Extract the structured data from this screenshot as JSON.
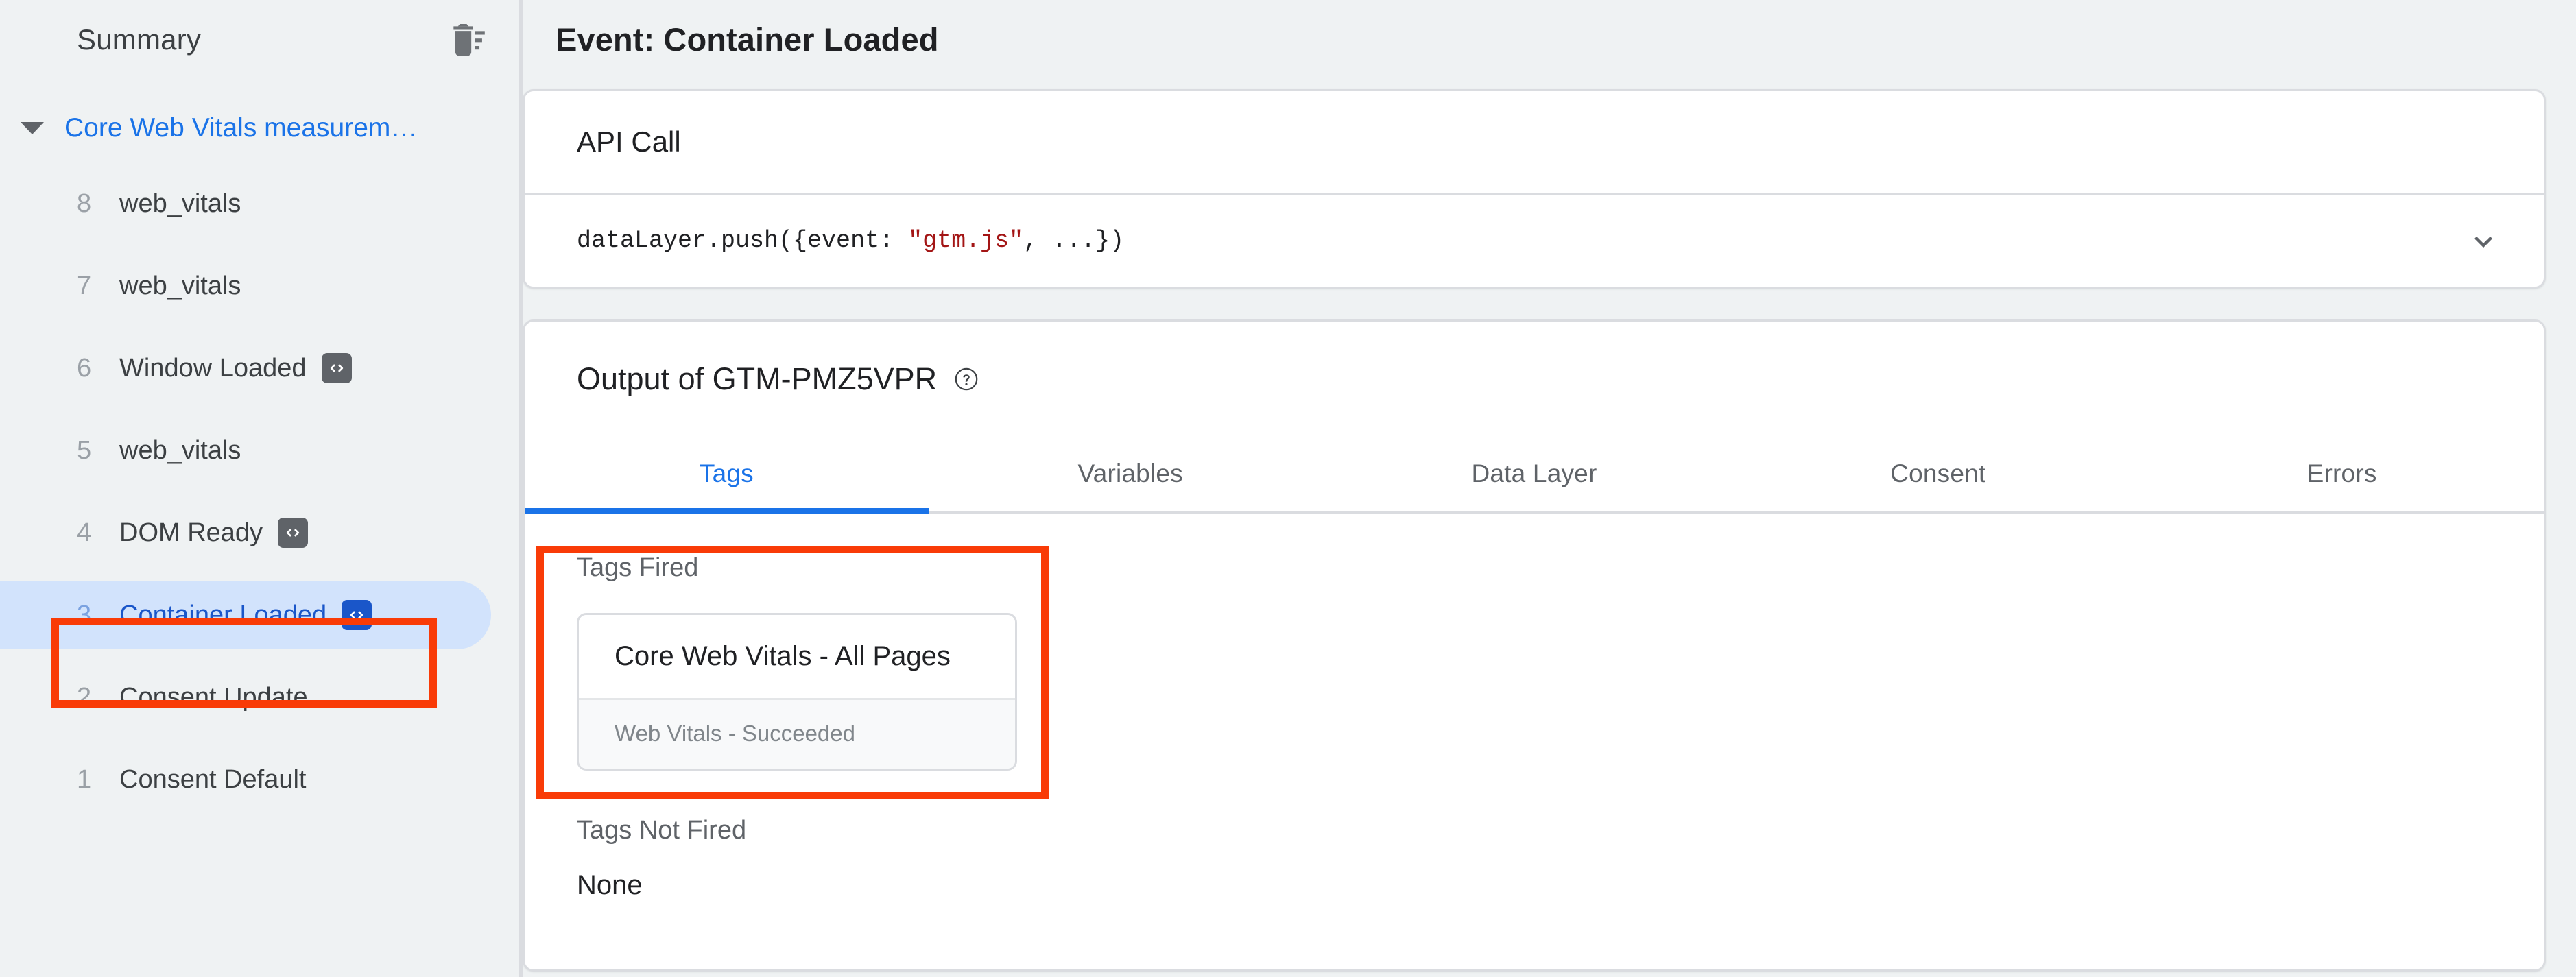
{
  "sidebar": {
    "title": "Summary",
    "clear_icon": "delete-sweep-icon",
    "group": {
      "label": "Core Web Vitals measurem…",
      "caret_icon": "caret-down-icon",
      "expanded": true
    },
    "events": [
      {
        "index": "8",
        "label": "web_vitals",
        "badge": false,
        "selected": false
      },
      {
        "index": "7",
        "label": "web_vitals",
        "badge": false,
        "selected": false
      },
      {
        "index": "6",
        "label": "Window Loaded",
        "badge": true,
        "selected": false,
        "badge_icon": "code-icon"
      },
      {
        "index": "5",
        "label": "web_vitals",
        "badge": false,
        "selected": false
      },
      {
        "index": "4",
        "label": "DOM Ready",
        "badge": true,
        "selected": false,
        "badge_icon": "code-icon"
      },
      {
        "index": "3",
        "label": "Container Loaded",
        "badge": true,
        "selected": true,
        "badge_icon": "code-icon"
      },
      {
        "index": "2",
        "label": "Consent Update",
        "badge": false,
        "selected": false
      },
      {
        "index": "1",
        "label": "Consent Default",
        "badge": false,
        "selected": false
      }
    ]
  },
  "main": {
    "page_title": "Event: Container Loaded",
    "api_card": {
      "heading": "API Call",
      "code_prefix": "dataLayer.push({event: ",
      "code_string": "\"gtm.js\"",
      "code_suffix": ", ...})",
      "expand_icon": "chevron-down-icon"
    },
    "output_card": {
      "heading": "Output of GTM-PMZ5VPR",
      "help_icon": "help-circle-icon",
      "tabs": [
        {
          "label": "Tags",
          "active": true
        },
        {
          "label": "Variables",
          "active": false
        },
        {
          "label": "Data Layer",
          "active": false
        },
        {
          "label": "Consent",
          "active": false
        },
        {
          "label": "Errors",
          "active": false
        }
      ],
      "tags_fired_label": "Tags Fired",
      "tags_fired": [
        {
          "name": "Core Web Vitals - All Pages",
          "status": "Web Vitals - Succeeded"
        }
      ],
      "tags_not_fired_label": "Tags Not Fired",
      "tags_not_fired_value": "None"
    }
  },
  "annotations": [
    {
      "name": "sidebar-container-loaded-highlight",
      "color": "#f93b07"
    },
    {
      "name": "tags-fired-highlight",
      "color": "#f93b07"
    }
  ],
  "colors": {
    "background": "#eff2f3",
    "accent_blue": "#1a73e8",
    "selected_pill": "#d2e3fc",
    "annotation_red": "#f93b07",
    "code_string_red": "#a31515"
  }
}
